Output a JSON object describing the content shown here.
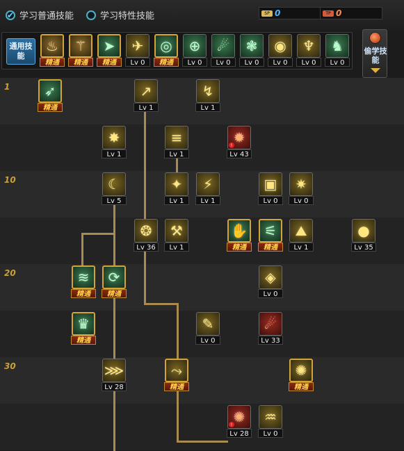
{
  "header": {
    "radio_normal_label": "学习普通技能",
    "radio_trait_label": "学习特性技能",
    "sp_value": "0",
    "tp_value": "0",
    "colors": {
      "sp_icon": "#d8b85a",
      "tp_icon": "#d85a3a",
      "sp_text": "#4fb4ff",
      "tp_text": "#ff8c4a"
    }
  },
  "quickbar": {
    "label": "通用技能",
    "slots": [
      {
        "icon": "rest-icon",
        "glyph": "♨",
        "tone": "gold",
        "mastered": true,
        "tag": "精通"
      },
      {
        "icon": "rise-icon",
        "glyph": "⚚",
        "tone": "gold",
        "mastered": true,
        "tag": "精通"
      },
      {
        "icon": "dash-icon",
        "glyph": "➤",
        "tone": "green",
        "mastered": true,
        "tag": "精通"
      },
      {
        "icon": "wings-icon",
        "glyph": "✈",
        "tone": "yellow",
        "mastered": false,
        "tag": "Lv 0"
      },
      {
        "icon": "target-icon",
        "glyph": "◎",
        "tone": "green",
        "mastered": true,
        "tag": "精通"
      },
      {
        "icon": "crosshair-icon",
        "glyph": "⊕",
        "tone": "green",
        "mastered": false,
        "tag": "Lv 0"
      },
      {
        "icon": "thrower-icon",
        "glyph": "☄",
        "tone": "green",
        "mastered": false,
        "tag": "Lv 0"
      },
      {
        "icon": "pet-icon",
        "glyph": "❃",
        "tone": "green",
        "mastered": false,
        "tag": "Lv 0"
      },
      {
        "icon": "eye-icon",
        "glyph": "◉",
        "tone": "yellow",
        "mastered": false,
        "tag": "Lv 0"
      },
      {
        "icon": "power-icon",
        "glyph": "♆",
        "tone": "yellow",
        "mastered": false,
        "tag": "Lv 0"
      },
      {
        "icon": "boots-icon",
        "glyph": "♞",
        "tone": "green",
        "mastered": false,
        "tag": "Lv 0"
      }
    ]
  },
  "steal_button": {
    "label": "偷学技能"
  },
  "levels": [
    "1",
    "10",
    "20",
    "30"
  ],
  "skills": [
    {
      "id": "s1",
      "icon": "kick-icon",
      "glyph": "➶",
      "tone": "green",
      "mastered": true,
      "tag": "精通"
    },
    {
      "id": "s2",
      "icon": "upper-icon",
      "glyph": "↗",
      "tone": "yellow",
      "mastered": false,
      "tag": "Lv 1"
    },
    {
      "id": "s3",
      "icon": "backstep-icon",
      "glyph": "↯",
      "tone": "yellow",
      "mastered": false,
      "tag": "Lv 1"
    },
    {
      "id": "s4",
      "icon": "burst-icon",
      "glyph": "✸",
      "tone": "yellow",
      "mastered": false,
      "tag": "Lv 1"
    },
    {
      "id": "s5",
      "icon": "gunshot-icon",
      "glyph": "≡",
      "tone": "yellow",
      "mastered": false,
      "tag": "Lv 1"
    },
    {
      "id": "s6",
      "icon": "flame-icon",
      "glyph": "✹",
      "tone": "red",
      "mastered": false,
      "tag": "Lv 43",
      "warn": true
    },
    {
      "id": "s7",
      "icon": "slash-icon",
      "glyph": "☾",
      "tone": "yellow",
      "mastered": false,
      "tag": "Lv 5"
    },
    {
      "id": "s8",
      "icon": "crush-icon",
      "glyph": "✦",
      "tone": "yellow",
      "mastered": false,
      "tag": "Lv 1"
    },
    {
      "id": "s9",
      "icon": "needle-icon",
      "glyph": "⚡",
      "tone": "yellow",
      "mastered": false,
      "tag": "Lv 1"
    },
    {
      "id": "s10",
      "icon": "box-icon",
      "glyph": "▣",
      "tone": "yellow",
      "mastered": false,
      "tag": "Lv 0"
    },
    {
      "id": "s11",
      "icon": "beast-icon",
      "glyph": "✷",
      "tone": "yellow",
      "mastered": false,
      "tag": "Lv 0"
    },
    {
      "id": "s12",
      "icon": "ring-icon",
      "glyph": "❂",
      "tone": "yellow",
      "mastered": false,
      "tag": "Lv 36"
    },
    {
      "id": "s13",
      "icon": "hammer-icon",
      "glyph": "⚒",
      "tone": "yellow",
      "mastered": false,
      "tag": "Lv 1"
    },
    {
      "id": "s14",
      "icon": "grab-icon",
      "glyph": "✋",
      "tone": "green",
      "mastered": true,
      "tag": "精通"
    },
    {
      "id": "s15",
      "icon": "shock-icon",
      "glyph": "⚟",
      "tone": "green",
      "mastered": true,
      "tag": "精通"
    },
    {
      "id": "s16",
      "icon": "ground-icon",
      "glyph": "⛰",
      "tone": "yellow",
      "mastered": false,
      "tag": "Lv 1"
    },
    {
      "id": "s17",
      "icon": "grenade-icon",
      "glyph": "●",
      "tone": "yellow",
      "mastered": false,
      "tag": "Lv 35"
    },
    {
      "id": "s18",
      "icon": "wave-icon",
      "glyph": "≋",
      "tone": "green",
      "mastered": true,
      "tag": "精通"
    },
    {
      "id": "s19",
      "icon": "spin-icon",
      "glyph": "⟳",
      "tone": "green",
      "mastered": true,
      "tag": "精通"
    },
    {
      "id": "s20",
      "icon": "shield-icon",
      "glyph": "◈",
      "tone": "yellow",
      "mastered": false,
      "tag": "Lv 0"
    },
    {
      "id": "s21",
      "icon": "dragon-icon",
      "glyph": "♛",
      "tone": "green",
      "mastered": true,
      "tag": "精通"
    },
    {
      "id": "s22",
      "icon": "drill-icon",
      "glyph": "✎",
      "tone": "yellow",
      "mastered": false,
      "tag": "Lv 0"
    },
    {
      "id": "s23",
      "icon": "dive-icon",
      "glyph": "☄",
      "tone": "red",
      "mastered": false,
      "tag": "Lv 33"
    },
    {
      "id": "s24",
      "icon": "claw-icon",
      "glyph": "⋙",
      "tone": "yellow",
      "mastered": false,
      "tag": "Lv 28"
    },
    {
      "id": "s25",
      "icon": "sweep-icon",
      "glyph": "⤳",
      "tone": "yellow",
      "mastered": true,
      "tag": "精通"
    },
    {
      "id": "s26",
      "icon": "whirl-icon",
      "glyph": "✺",
      "tone": "yellow",
      "mastered": true,
      "tag": "精通"
    },
    {
      "id": "s27",
      "icon": "explosion-icon",
      "glyph": "✺",
      "tone": "red",
      "mastered": false,
      "tag": "Lv 28",
      "warn": true
    },
    {
      "id": "s28",
      "icon": "meteor-icon",
      "glyph": "♒",
      "tone": "yellow",
      "mastered": false,
      "tag": "Lv 0"
    }
  ]
}
